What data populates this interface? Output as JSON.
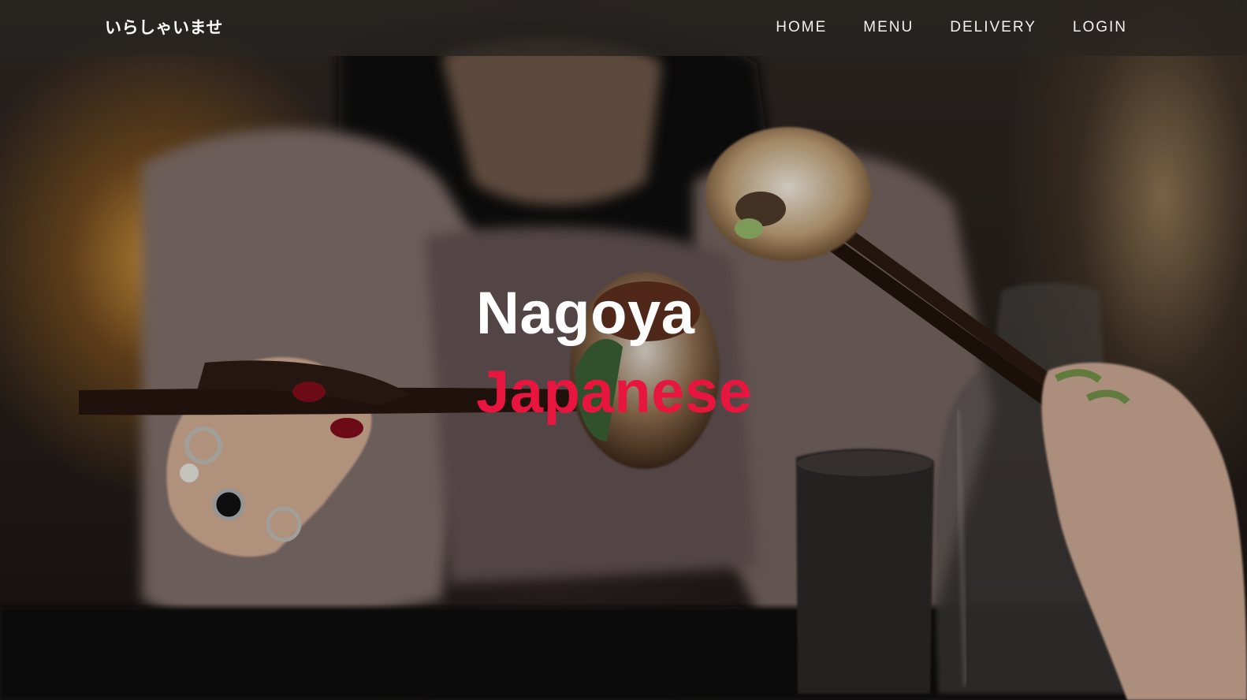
{
  "brand": {
    "text": "いらしゃいませ"
  },
  "nav": {
    "items": [
      {
        "label": "HOME"
      },
      {
        "label": "MENU"
      },
      {
        "label": "DELIVERY"
      },
      {
        "label": "LOGIN"
      }
    ]
  },
  "hero": {
    "line1": "Nagoya",
    "line2": "Japanese",
    "background_description": "sushi held with chopsticks"
  },
  "colors": {
    "accent": "#e8163f",
    "nav_background": "#28241f",
    "text": "#ffffff"
  }
}
